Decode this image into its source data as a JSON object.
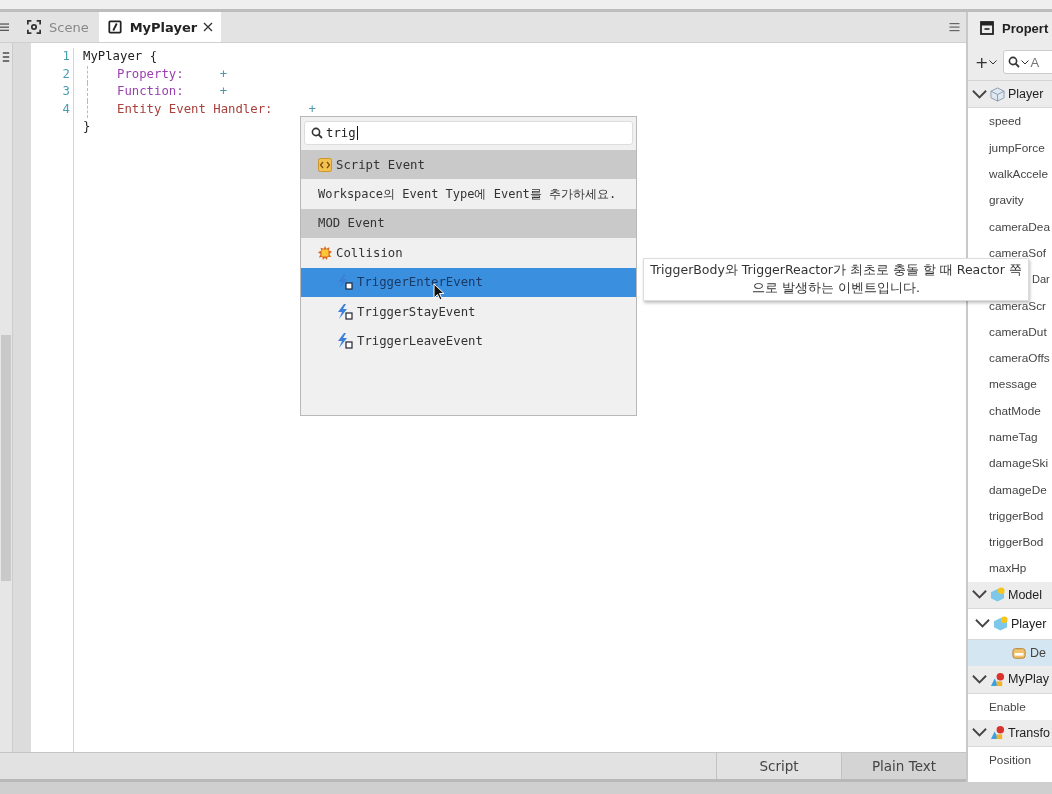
{
  "left_tabs": [
    {
      "label": "Scene",
      "kind": "scene",
      "selected": false,
      "closable": false
    },
    {
      "label": "MyPlayer",
      "kind": "script",
      "selected": true,
      "closable": true
    }
  ],
  "code_lines": [
    {
      "number": "1",
      "kind": "plain",
      "text": "MyPlayer {"
    },
    {
      "number": "2",
      "kind": "member",
      "text": "Property:",
      "plus": "+"
    },
    {
      "number": "3",
      "kind": "member",
      "text": "Function:",
      "plus": "+"
    },
    {
      "number": "4",
      "kind": "handler",
      "text": "Entity Event Handler:",
      "plus": "+"
    },
    {
      "kind": "plain",
      "text": "}"
    }
  ],
  "popup": {
    "search_value": "trig",
    "rows": [
      {
        "kind": "script_header",
        "text": "Script Event"
      },
      {
        "kind": "info",
        "text": "Workspace의 Event Type에 Event를 추가하세요."
      },
      {
        "kind": "header",
        "text": "MOD Event"
      },
      {
        "kind": "group",
        "text": "Collision"
      },
      {
        "kind": "item",
        "text": "TriggerEnterEvent",
        "selected": true
      },
      {
        "kind": "item",
        "text": "TriggerStayEvent",
        "selected": false
      },
      {
        "kind": "item",
        "text": "TriggerLeaveEvent",
        "selected": false
      }
    ]
  },
  "tooltip": "TriggerBody와 TriggerReactor가 최초로 충돌 할 때 Reactor 쪽 으로 발생하는 이벤트입니다.",
  "editor_tabs": [
    {
      "label": "Script",
      "selected": true
    },
    {
      "label": "Plain Text",
      "selected": false
    }
  ],
  "properties": {
    "title": "Propert",
    "add_button": "+",
    "search_placeholder": "A",
    "rows": [
      {
        "kind": "entity_group",
        "text": "Player"
      },
      {
        "kind": "field",
        "text": "speed"
      },
      {
        "kind": "field",
        "text": "jumpForce"
      },
      {
        "kind": "field",
        "text": "walkAccele"
      },
      {
        "kind": "field",
        "text": "gravity"
      },
      {
        "kind": "field",
        "text": "cameraDea"
      },
      {
        "kind": "field",
        "text": "cameraSof"
      },
      {
        "kind": "covered",
        "text": "Dar"
      },
      {
        "kind": "field",
        "text": "cameraScr"
      },
      {
        "kind": "field",
        "text": "cameraDut"
      },
      {
        "kind": "field",
        "text": "cameraOffs"
      },
      {
        "kind": "field",
        "text": "message"
      },
      {
        "kind": "field",
        "text": "chatMode"
      },
      {
        "kind": "field",
        "text": "nameTag"
      },
      {
        "kind": "field",
        "text": "damageSki"
      },
      {
        "kind": "field",
        "text": "damageDe"
      },
      {
        "kind": "field",
        "text": "triggerBod"
      },
      {
        "kind": "field",
        "text": "triggerBod"
      },
      {
        "kind": "field",
        "text": "maxHp"
      },
      {
        "kind": "model_group",
        "text": "Model"
      },
      {
        "kind": "model_subgroup",
        "text": "Player"
      },
      {
        "kind": "child",
        "text": "De",
        "selected": true
      },
      {
        "kind": "component_group",
        "text": "MyPlay"
      },
      {
        "kind": "field",
        "text": "Enable"
      },
      {
        "kind": "component_group",
        "text": "Transfo"
      },
      {
        "kind": "field",
        "text": "Position"
      }
    ]
  }
}
